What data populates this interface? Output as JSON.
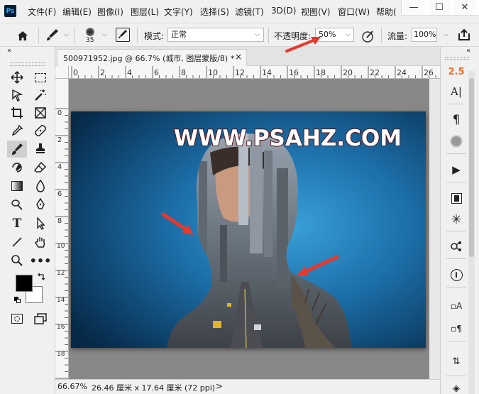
{
  "app": {
    "logo_text": "Ps"
  },
  "menu": {
    "items": [
      {
        "label": "文件(F)"
      },
      {
        "label": "编辑(E)"
      },
      {
        "label": "图像(I)"
      },
      {
        "label": "图层(L)"
      },
      {
        "label": "文字(Y)"
      },
      {
        "label": "选择(S)"
      },
      {
        "label": "滤镜(T)"
      },
      {
        "label": "3D(D)"
      },
      {
        "label": "视图(V)"
      },
      {
        "label": "窗口(W)"
      },
      {
        "label": "帮助("
      }
    ]
  },
  "window_controls": {
    "minimize": "—",
    "maximize": "☐",
    "close": "✕"
  },
  "options_bar": {
    "brush_size": "35",
    "mode_label": "模式:",
    "mode_value": "正常",
    "opacity_label": "不透明度:",
    "opacity_value": "50%",
    "flow_label": "流量:",
    "flow_value": "100%"
  },
  "document": {
    "tab_title": "500971952.jpg @ 66.7% (城市, 图层蒙版/8) *",
    "tab_close": "×",
    "watermark_text": "WWW.PSAHZ.COM"
  },
  "rulers": {
    "horizontal": [
      "0",
      "2",
      "4",
      "6",
      "8",
      "10",
      "12",
      "14",
      "16",
      "18",
      "20",
      "22",
      "24",
      "26"
    ],
    "vertical": [
      "0",
      "2",
      "4",
      "6",
      "8",
      "10",
      "12",
      "14",
      "16",
      "18"
    ]
  },
  "status_bar": {
    "zoom": "66.67%",
    "doc_info": "26.46 厘米 x 17.64 厘米 (72 ppi)",
    "arrow": ">"
  },
  "right_panel": {
    "collapse": "«",
    "char_value": "2.5"
  },
  "toolbar": {
    "collapse": "«"
  },
  "colors": {
    "foreground": "#000000",
    "background": "#ffffff",
    "accent_arrow": "#e8382c",
    "canvas_bg": "#888888"
  }
}
